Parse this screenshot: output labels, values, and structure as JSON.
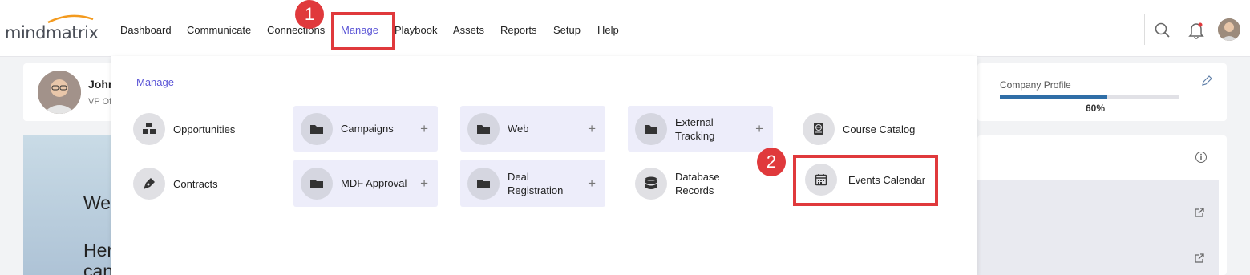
{
  "logo": "mindmatrix",
  "nav": [
    {
      "label": "Dashboard"
    },
    {
      "label": "Communicate"
    },
    {
      "label": "Connections"
    },
    {
      "label": "Manage"
    },
    {
      "label": "Playbook"
    },
    {
      "label": "Assets"
    },
    {
      "label": "Reports"
    },
    {
      "label": "Setup"
    },
    {
      "label": "Help"
    }
  ],
  "profile": {
    "name": "John",
    "title": "VP Of"
  },
  "company_profile": {
    "label": "Company Profile",
    "percent_text": "60%",
    "progress": 0.6
  },
  "welcome": {
    "line1": "We",
    "line2": "Her",
    "line3": "can"
  },
  "menu": {
    "title": "Manage",
    "items": [
      {
        "label": "Opportunities",
        "icon": "cubes-icon"
      },
      {
        "label": "Contracts",
        "icon": "pen-nib-icon"
      },
      {
        "label": "Campaigns",
        "icon": "folder-icon",
        "expand": "+"
      },
      {
        "label": "MDF Approval",
        "icon": "folder-icon",
        "expand": "+"
      },
      {
        "label": "Web",
        "icon": "folder-icon",
        "expand": "+"
      },
      {
        "label": "Deal Registration",
        "line1": "Deal",
        "line2": "Registration",
        "icon": "folder-icon",
        "expand": "+"
      },
      {
        "label": "External Tracking",
        "line1": "External",
        "line2": "Tracking",
        "icon": "folder-icon",
        "expand": "+"
      },
      {
        "label": "Database Records",
        "line1": "Database",
        "line2": "Records",
        "icon": "database-icon"
      },
      {
        "label": "Course Catalog",
        "icon": "book-globe-icon"
      },
      {
        "label": "Events Calendar",
        "icon": "calendar-icon"
      }
    ]
  },
  "callouts": {
    "step1": "1",
    "step2": "2"
  },
  "colors": {
    "accent": "#5b55d6",
    "callout": "#e0393c",
    "progress": "#2f6ea7"
  }
}
